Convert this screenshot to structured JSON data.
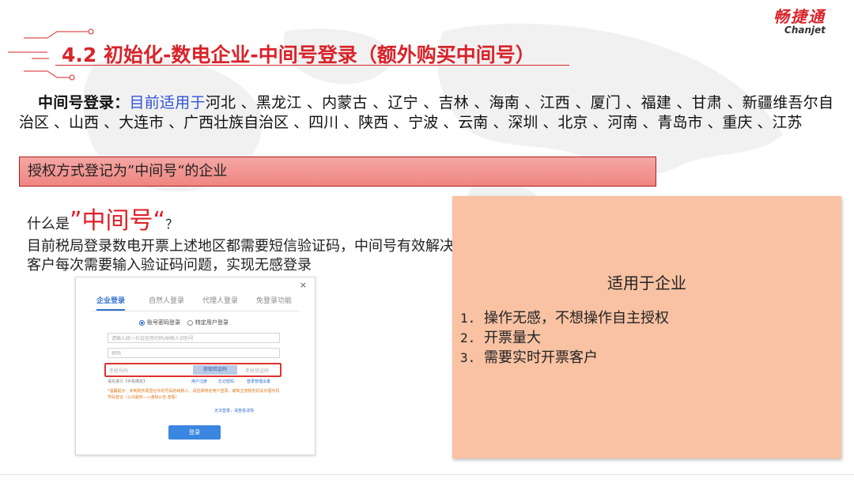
{
  "logo": {
    "cn": "畅捷通",
    "en": "Chanjet",
    "color": "#d8232a"
  },
  "title": "4.2 初始化-数电企业-中间号登录（额外购买中间号）",
  "lead": {
    "label": "中间号登录：",
    "highlight": "目前适用于",
    "regions": "河北 、黑龙江 、内蒙古 、辽宁 、吉林 、海南 、江西 、厦门 、福建 、甘肃 、新疆维吾尔自治区 、山西 、大连市 、广西壮族自治区 、四川 、陕西 、宁波 、云南 、深圳 、北京 、河南 、青岛市 、重庆 、江苏"
  },
  "auth_box": "授权方式登记为”中间号“的企业",
  "question": {
    "prefix": "什么是",
    "term": "”中间号“",
    "suffix": "？"
  },
  "explanation": "目前税局登录数电开票上述地区都需要短信验证码，中间号有效解决客户每次需要输入验证码问题，实现无感登录",
  "screenshot": {
    "close": "×",
    "tabs": [
      "企业登录",
      "自然人登录",
      "代理人登录",
      "免登录功能"
    ],
    "radios": [
      "账号密码登录",
      "特定用户登录"
    ],
    "fields": [
      "请输入统一社会信用代码/纳税人识别号",
      "密码"
    ],
    "sms_placeholder": "手机号码",
    "sms_button": "获取验证码",
    "sms_code_placeholder": "手机验证码",
    "links": {
      "remember": "请先进行【手机绑定】",
      "register": "用户注册",
      "forgot": "忘记密码",
      "manage": "登录管理设置"
    },
    "tip": "*温馨提示：未到税务局登记手机号码的纳税人，请选择特定用户登录，或到主管税务机关办理手机号码登记（公众服务—>通知公告 查看）",
    "tip_link": "无法登录，请查看详情",
    "login": "登录"
  },
  "panel": {
    "title": "适用于企业",
    "items": [
      {
        "num": "1.",
        "text": "操作无感，不想操作自主授权"
      },
      {
        "num": "2.",
        "text": "开票量大"
      },
      {
        "num": "3.",
        "text": "需要实时开票客户"
      }
    ],
    "color": "#f8c2a3"
  },
  "accent_color": "#d8232a"
}
